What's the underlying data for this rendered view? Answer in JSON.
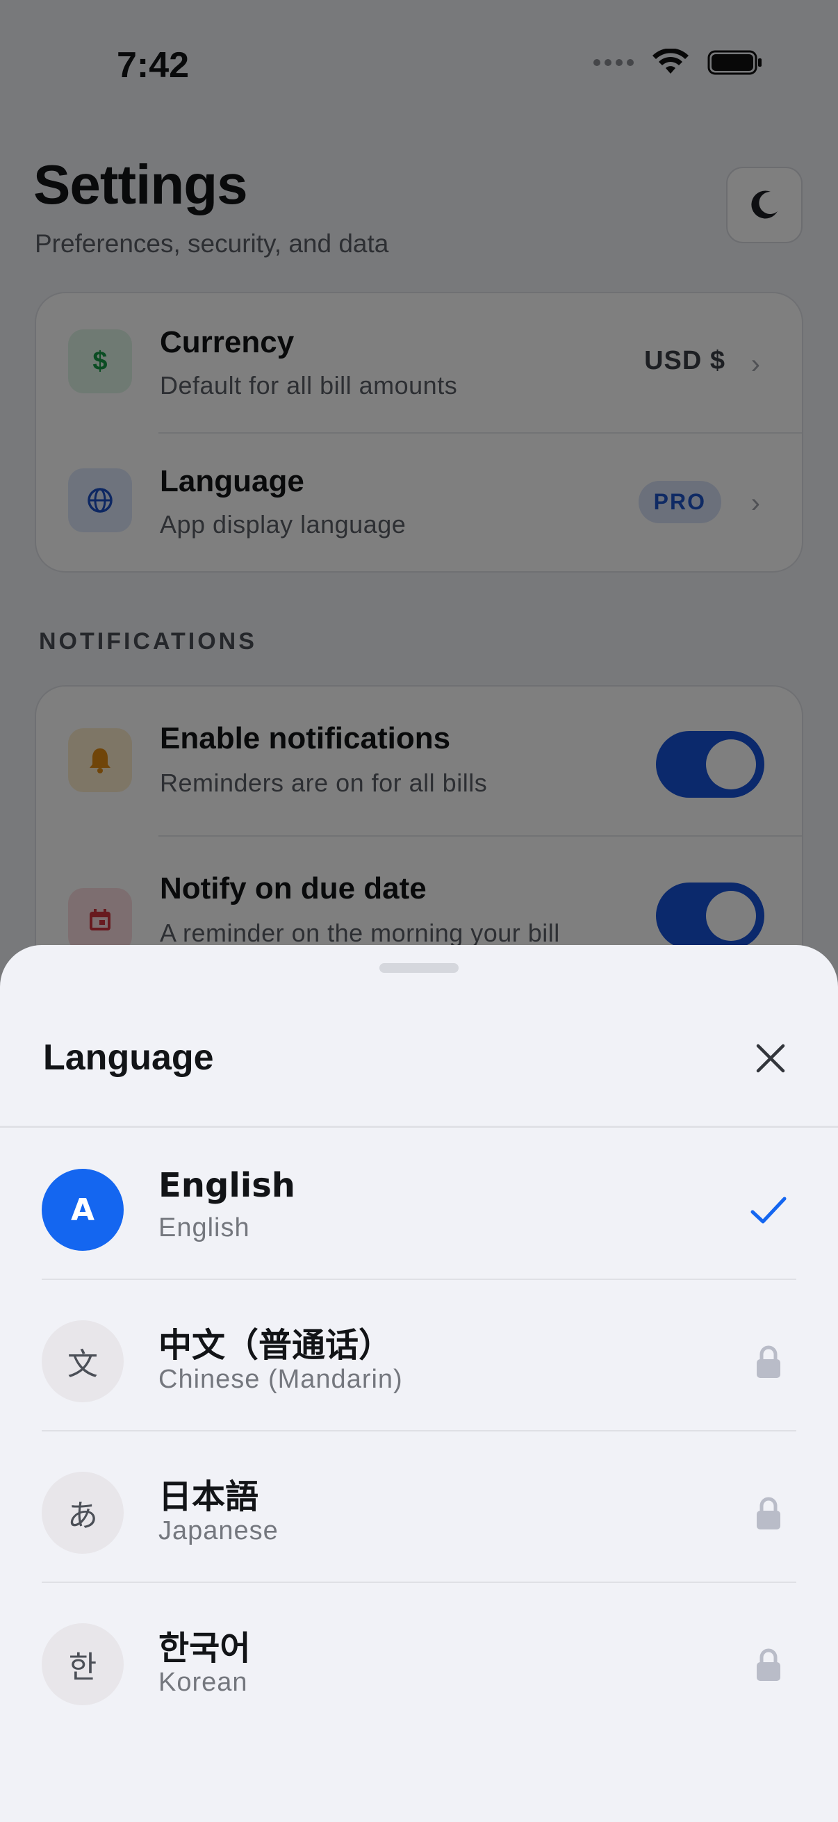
{
  "status_bar": {
    "time": "7:42"
  },
  "header": {
    "title": "Settings",
    "subtitle": "Preferences, security, and data",
    "theme_icon": "moon-icon"
  },
  "general": {
    "currency": {
      "title": "Currency",
      "subtitle": "Default for all bill amounts",
      "value": "USD $",
      "icon": "dollar-icon"
    },
    "language": {
      "title": "Language",
      "subtitle": "App display language",
      "badge": "PRO",
      "icon": "globe-icon"
    }
  },
  "notifications": {
    "section_label": "NOTIFICATIONS",
    "enable": {
      "title": "Enable notifications",
      "subtitle": "Reminders are on for all bills",
      "enabled": true,
      "icon": "bell-icon"
    },
    "due_date": {
      "title": "Notify on due date",
      "subtitle": "A reminder on the morning your bill",
      "enabled": true,
      "icon": "calendar-icon"
    }
  },
  "sheet": {
    "title": "Language",
    "languages": [
      {
        "glyph": "A",
        "name": "English",
        "english": "English",
        "selected": true,
        "locked": false
      },
      {
        "glyph": "文",
        "name": "中文（普通话）",
        "english": "Chinese (Mandarin)",
        "selected": false,
        "locked": true
      },
      {
        "glyph": "あ",
        "name": "日本語",
        "english": "Japanese",
        "selected": false,
        "locked": true
      },
      {
        "glyph": "한",
        "name": "한국어",
        "english": "Korean",
        "selected": false,
        "locked": true
      }
    ]
  },
  "colors": {
    "accent": "#1466f0",
    "toggle_on": "#1652d8",
    "sheet_bg": "#f1f2f7"
  }
}
